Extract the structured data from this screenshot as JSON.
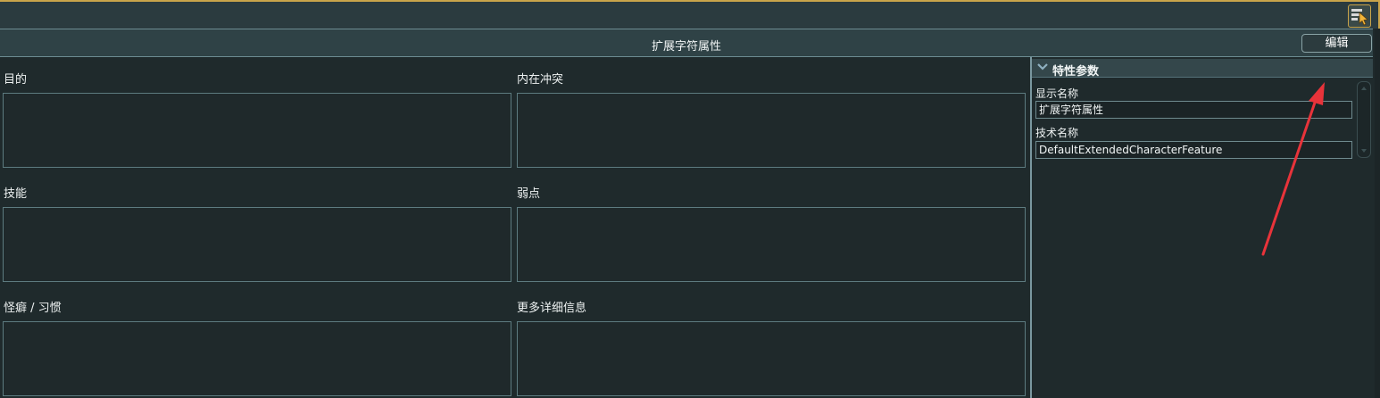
{
  "header": {
    "title": "扩展字符属性",
    "edit_label": "编辑",
    "tool_icon": "cursor-panel-icon"
  },
  "fields": [
    {
      "label": "目的",
      "value": ""
    },
    {
      "label": "内在冲突",
      "value": ""
    },
    {
      "label": "技能",
      "value": ""
    },
    {
      "label": "弱点",
      "value": ""
    },
    {
      "label": "怪癖 / 习惯",
      "value": ""
    },
    {
      "label": "更多详细信息",
      "value": ""
    }
  ],
  "properties": {
    "section_title": "特性参数",
    "display_name_label": "显示名称",
    "display_name_value": "扩展字符属性",
    "tech_name_label": "技术名称",
    "tech_name_value": "DefaultExtendedCharacterFeature"
  },
  "colors": {
    "accent_border": "#c9a44a",
    "annotation_arrow": "#e8333a"
  }
}
